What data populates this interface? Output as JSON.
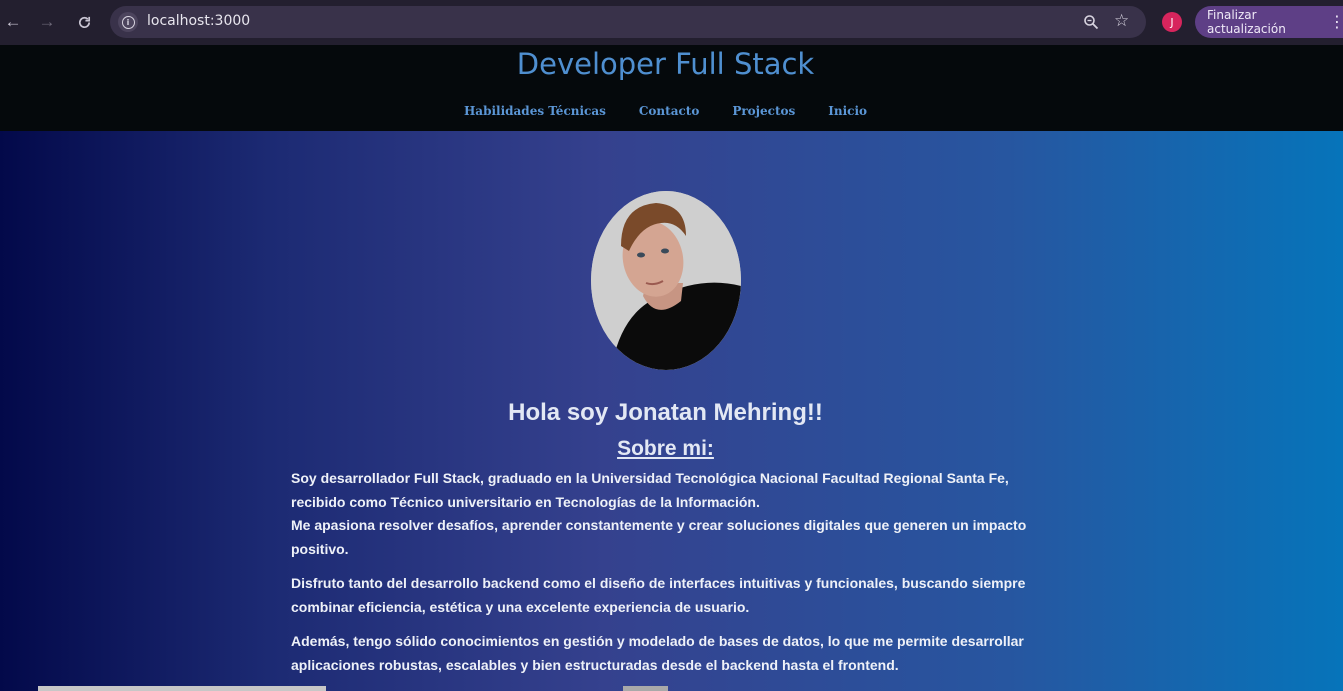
{
  "browser": {
    "url": "localhost:3000",
    "profile_initial": "J",
    "update_button": "Finalizar actualización",
    "back_icon": "arrow-left-icon",
    "forward_icon": "arrow-right-icon",
    "reload_icon": "reload-icon",
    "zoom_icon": "zoom-icon",
    "bookmark_icon": "star-icon",
    "menu_icon": "vertical-dots-icon"
  },
  "header": {
    "title": "Developer Full Stack",
    "nav": [
      "Habilidades Técnicas",
      "Contacto",
      "Projectos",
      "Inicio"
    ]
  },
  "main": {
    "greeting": "Hola soy Jonatan Mehring!!",
    "about_title": "Sobre mi:",
    "paragraphs": [
      "Soy desarrollador Full Stack, graduado en la Universidad Tecnológica Nacional Facultad Regional Santa Fe, recibido como Técnico universitario en Tecnologías de la Información.",
      "Me apasiona resolver desafíos, aprender constantemente y crear soluciones digitales que generen un impacto positivo.",
      "Disfruto tanto del desarrollo backend como el diseño de interfaces intuitivas y funcionales, buscando siempre combinar eficiencia, estética y una excelente experiencia de usuario.",
      "Además, tengo sólido conocimientos en gestión y modelado de bases de datos, lo que me permite desarrollar aplicaciones robustas, escalables y bien estructuradas desde el backend hasta el frontend."
    ]
  },
  "colors": {
    "title": "#4f8fd0",
    "header_bg": "#05090c",
    "gradient_start": "#03094a",
    "gradient_end": "#0674ba"
  }
}
